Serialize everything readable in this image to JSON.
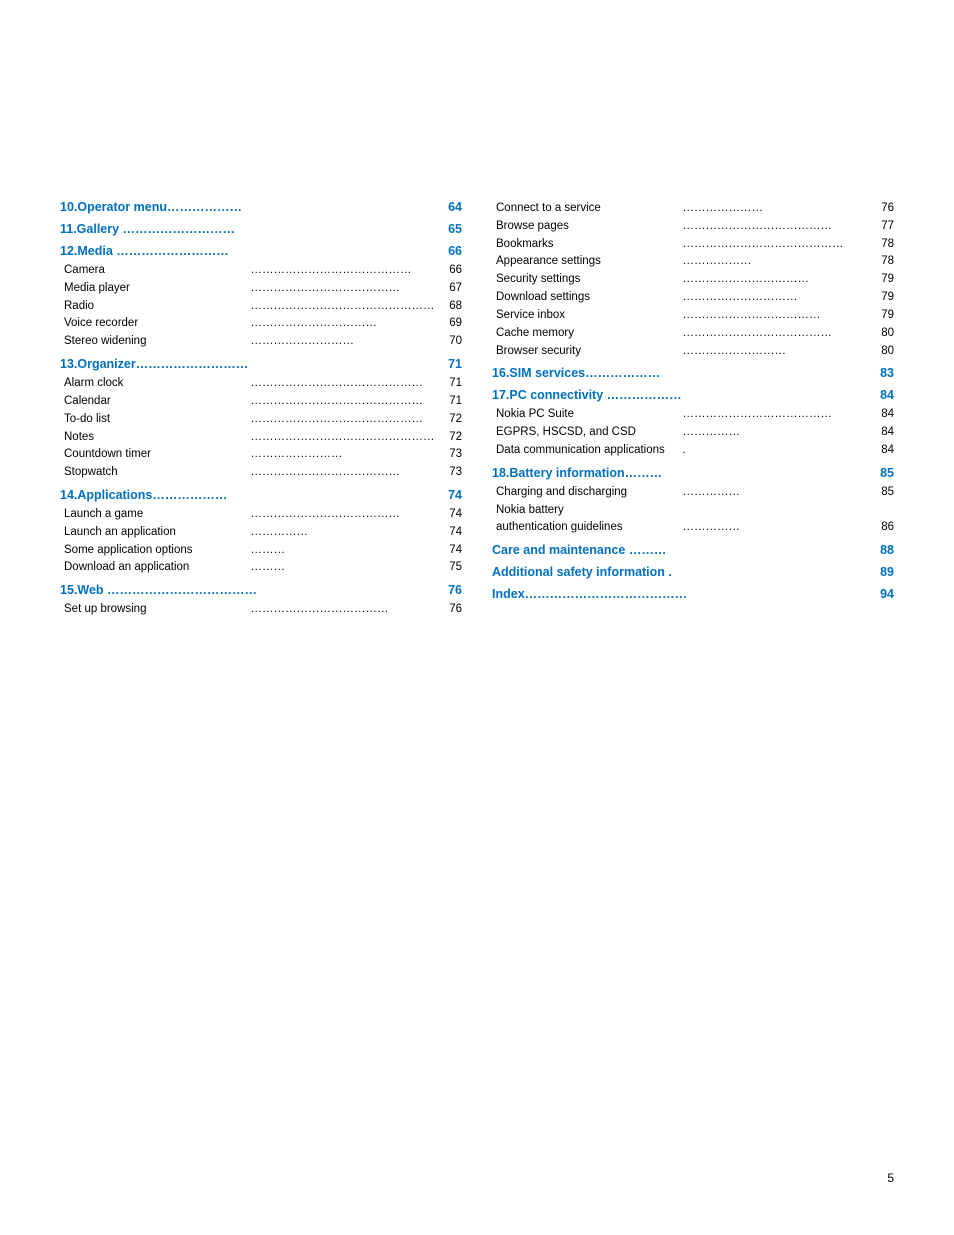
{
  "page": {
    "number": "5"
  },
  "left_column": {
    "sections": [
      {
        "id": "operator-menu",
        "heading": "10.Operator menu………………",
        "heading_page": "64",
        "items": []
      },
      {
        "id": "gallery",
        "heading": "11.Gallery ………………………",
        "heading_page": "65",
        "items": []
      },
      {
        "id": "media",
        "heading": "12.Media ………………………",
        "heading_page": "66",
        "items": [
          {
            "label": "Camera",
            "dots": "……………………………………",
            "page": "66"
          },
          {
            "label": "Media player",
            "dots": "…………………………………",
            "page": "67"
          },
          {
            "label": "Radio",
            "dots": "…………………………………………",
            "page": "68"
          },
          {
            "label": "Voice recorder",
            "dots": "……………………………",
            "page": "69"
          },
          {
            "label": "Stereo widening",
            "dots": "………………………",
            "page": "70"
          }
        ]
      },
      {
        "id": "organizer",
        "heading": "13.Organizer………………………",
        "heading_page": "71",
        "items": [
          {
            "label": "Alarm clock",
            "dots": "………………………………………",
            "page": "71"
          },
          {
            "label": "Calendar",
            "dots": "………………………………………",
            "page": "71"
          },
          {
            "label": "To-do list",
            "dots": "………………………………………",
            "page": "72"
          },
          {
            "label": "Notes",
            "dots": "…………………………………………",
            "page": "72"
          },
          {
            "label": "Countdown timer",
            "dots": "……………………",
            "page": "73"
          },
          {
            "label": "Stopwatch",
            "dots": "…………………………………",
            "page": "73"
          }
        ]
      },
      {
        "id": "applications",
        "heading": "14.Applications………………",
        "heading_page": "74",
        "items": [
          {
            "label": "Launch a game",
            "dots": "…………………………………",
            "page": "74"
          },
          {
            "label": "Launch an application",
            "dots": "……………",
            "page": "74"
          },
          {
            "label": "Some application options",
            "dots": "………",
            "page": "74"
          },
          {
            "label": "Download an application",
            "dots": "………",
            "page": "75"
          }
        ]
      },
      {
        "id": "web",
        "heading": "15.Web ………………………………",
        "heading_page": "76",
        "items": [
          {
            "label": "Set up browsing",
            "dots": "………………………………",
            "page": "76"
          }
        ]
      }
    ]
  },
  "right_column": {
    "sections": [
      {
        "id": "web-items",
        "heading": null,
        "heading_page": null,
        "items": [
          {
            "label": "Connect to a service",
            "dots": "…………………",
            "page": "76"
          },
          {
            "label": "Browse pages",
            "dots": "…………………………………",
            "page": "77"
          },
          {
            "label": "Bookmarks",
            "dots": "……………………………………",
            "page": "78"
          },
          {
            "label": "Appearance settings",
            "dots": "………………",
            "page": "78"
          },
          {
            "label": "Security settings",
            "dots": "……………………………",
            "page": "79"
          },
          {
            "label": "Download settings",
            "dots": "…………………………",
            "page": "79"
          },
          {
            "label": "Service inbox",
            "dots": "………………………………",
            "page": "79"
          },
          {
            "label": "Cache memory",
            "dots": "…………………………………",
            "page": "80"
          },
          {
            "label": "Browser security",
            "dots": "………………………",
            "page": "80"
          }
        ]
      },
      {
        "id": "sim-services",
        "heading": "16.SIM services………………",
        "heading_page": "83",
        "items": []
      },
      {
        "id": "pc-connectivity",
        "heading": "17.PC connectivity ………………",
        "heading_page": "84",
        "items": [
          {
            "label": "Nokia PC Suite",
            "dots": "…………………………………",
            "page": "84"
          },
          {
            "label": "EGPRS, HSCSD, and CSD",
            "dots": "……………",
            "page": "84"
          },
          {
            "label": "Data communication applications",
            "dots": ".",
            "page": "84"
          }
        ]
      },
      {
        "id": "battery-information",
        "heading": "18.Battery information………",
        "heading_page": "85",
        "items": [
          {
            "label": "Charging and discharging",
            "dots": "……………",
            "page": "85"
          },
          {
            "label": "Nokia battery",
            "dots": "",
            "page": ""
          },
          {
            "label": "authentication guidelines",
            "dots": "……………",
            "page": "86"
          }
        ]
      },
      {
        "id": "care-maintenance",
        "heading": "Care and maintenance ………",
        "heading_page": "88",
        "items": []
      },
      {
        "id": "safety-information",
        "heading": "Additional safety information .",
        "heading_page": "89",
        "items": []
      },
      {
        "id": "index",
        "heading": "Index…………………………………",
        "heading_page": "94",
        "items": []
      }
    ]
  }
}
